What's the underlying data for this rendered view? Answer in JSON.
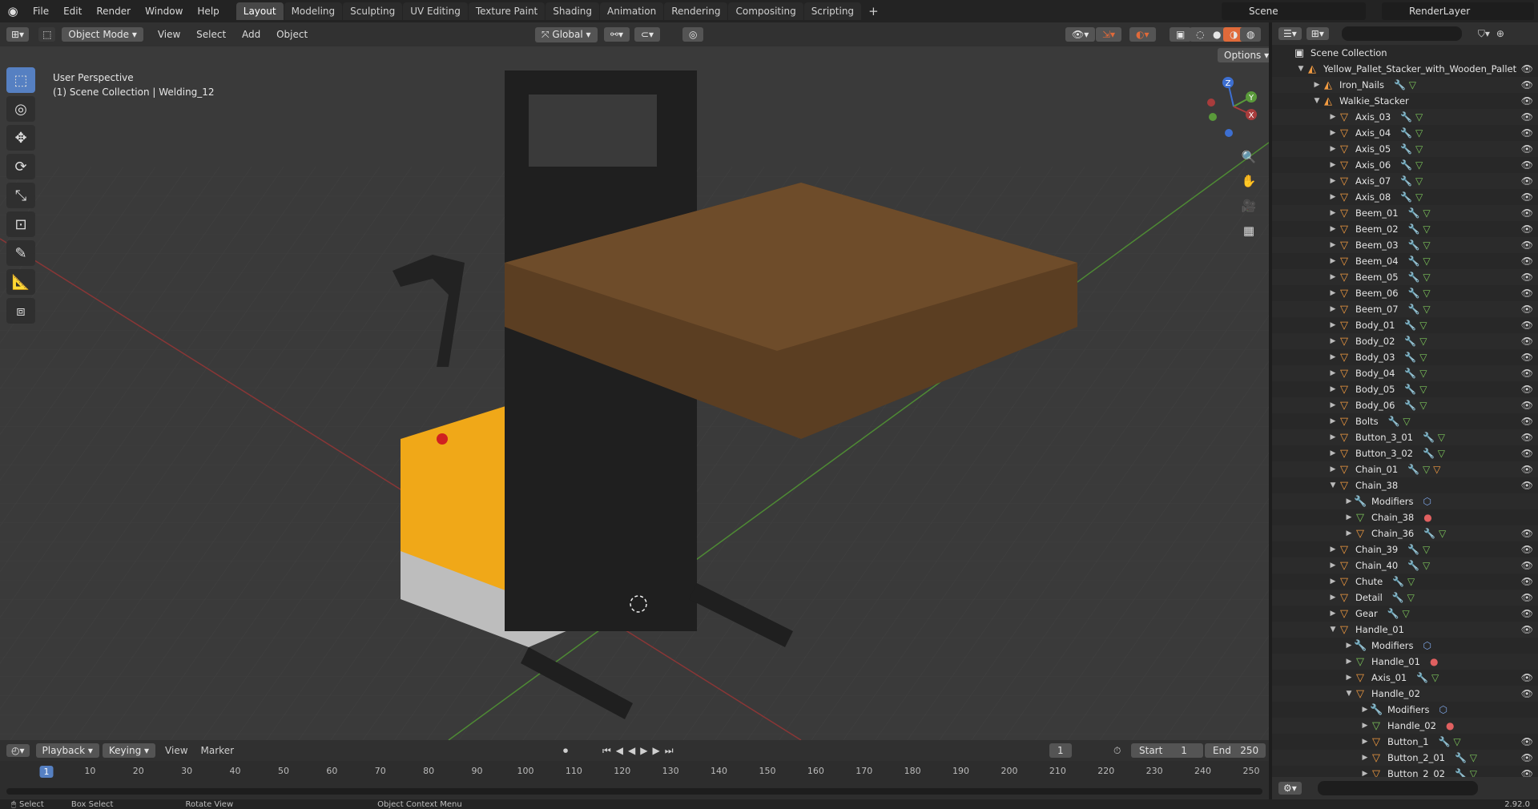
{
  "topbar": {
    "menus": [
      "File",
      "Edit",
      "Render",
      "Window",
      "Help"
    ],
    "workspaces": [
      "Layout",
      "Modeling",
      "Sculpting",
      "UV Editing",
      "Texture Paint",
      "Shading",
      "Animation",
      "Rendering",
      "Compositing",
      "Scripting"
    ],
    "active_workspace": "Layout",
    "add_tab": "+",
    "scene": "Scene",
    "render_layer": "RenderLayer"
  },
  "viewport": {
    "mode": "Object Mode",
    "menus": [
      "View",
      "Select",
      "Add",
      "Object"
    ],
    "transform_orientation": "Global",
    "options": "Options",
    "info_line1": "User Perspective",
    "info_line2": "(1) Scene Collection | Welding_12",
    "gizmo_axes": {
      "z": "Z",
      "y": "Y",
      "x": "X"
    },
    "colors": {
      "x_axis": "#a83c3c",
      "y_axis": "#5a9a3a",
      "z_axis": "#3d6fd1",
      "accent": "#5680c2",
      "yellow": "#f0a818"
    }
  },
  "outliner": {
    "root": "Scene Collection",
    "rows": [
      {
        "depth": 1,
        "label": "Yellow_Pallet_Stacker_with_Wooden_Pallet",
        "open": true,
        "icon": "armature",
        "extras": ""
      },
      {
        "depth": 2,
        "label": "Iron_Nails",
        "open": false,
        "icon": "armature",
        "extras": "mod-mesh"
      },
      {
        "depth": 2,
        "label": "Walkie_Stacker",
        "open": true,
        "icon": "armature",
        "extras": ""
      },
      {
        "depth": 3,
        "label": "Axis_03",
        "open": false,
        "icon": "mesh",
        "extras": "mod-mesh"
      },
      {
        "depth": 3,
        "label": "Axis_04",
        "open": false,
        "icon": "mesh",
        "extras": "mod-mesh"
      },
      {
        "depth": 3,
        "label": "Axis_05",
        "open": false,
        "icon": "mesh",
        "extras": "mod-mesh"
      },
      {
        "depth": 3,
        "label": "Axis_06",
        "open": false,
        "icon": "mesh",
        "extras": "mod-mesh"
      },
      {
        "depth": 3,
        "label": "Axis_07",
        "open": false,
        "icon": "mesh",
        "extras": "mod-mesh"
      },
      {
        "depth": 3,
        "label": "Axis_08",
        "open": false,
        "icon": "mesh",
        "extras": "mod-mesh"
      },
      {
        "depth": 3,
        "label": "Beem_01",
        "open": false,
        "icon": "mesh",
        "extras": "mod-mesh"
      },
      {
        "depth": 3,
        "label": "Beem_02",
        "open": false,
        "icon": "mesh",
        "extras": "mod-mesh"
      },
      {
        "depth": 3,
        "label": "Beem_03",
        "open": false,
        "icon": "mesh",
        "extras": "mod-mesh"
      },
      {
        "depth": 3,
        "label": "Beem_04",
        "open": false,
        "icon": "mesh",
        "extras": "mod-mesh"
      },
      {
        "depth": 3,
        "label": "Beem_05",
        "open": false,
        "icon": "mesh",
        "extras": "mod-mesh"
      },
      {
        "depth": 3,
        "label": "Beem_06",
        "open": false,
        "icon": "mesh",
        "extras": "mod-mesh"
      },
      {
        "depth": 3,
        "label": "Beem_07",
        "open": false,
        "icon": "mesh",
        "extras": "mod-mesh"
      },
      {
        "depth": 3,
        "label": "Body_01",
        "open": false,
        "icon": "mesh",
        "extras": "mod-mesh"
      },
      {
        "depth": 3,
        "label": "Body_02",
        "open": false,
        "icon": "mesh",
        "extras": "mod-mesh"
      },
      {
        "depth": 3,
        "label": "Body_03",
        "open": false,
        "icon": "mesh",
        "extras": "mod-mesh"
      },
      {
        "depth": 3,
        "label": "Body_04",
        "open": false,
        "icon": "mesh",
        "extras": "mod-mesh"
      },
      {
        "depth": 3,
        "label": "Body_05",
        "open": false,
        "icon": "mesh",
        "extras": "mod-mesh"
      },
      {
        "depth": 3,
        "label": "Body_06",
        "open": false,
        "icon": "mesh",
        "extras": "mod-mesh"
      },
      {
        "depth": 3,
        "label": "Bolts",
        "open": false,
        "icon": "mesh",
        "extras": "mod-mesh"
      },
      {
        "depth": 3,
        "label": "Button_3_01",
        "open": false,
        "icon": "mesh",
        "extras": "mod-mesh"
      },
      {
        "depth": 3,
        "label": "Button_3_02",
        "open": false,
        "icon": "mesh",
        "extras": "mod-mesh"
      },
      {
        "depth": 3,
        "label": "Chain_01",
        "open": false,
        "icon": "mesh",
        "extras": "mod-mesh-child"
      },
      {
        "depth": 3,
        "label": "Chain_38",
        "open": true,
        "icon": "mesh",
        "extras": ""
      },
      {
        "depth": 4,
        "label": "Modifiers",
        "open": false,
        "icon": "wrench",
        "extras": "modifier"
      },
      {
        "depth": 4,
        "label": "Chain_38",
        "open": false,
        "icon": "meshdata",
        "extras": "material"
      },
      {
        "depth": 4,
        "label": "Chain_36",
        "open": false,
        "icon": "mesh",
        "extras": "mod-mesh"
      },
      {
        "depth": 3,
        "label": "Chain_39",
        "open": false,
        "icon": "mesh",
        "extras": "mod-mesh"
      },
      {
        "depth": 3,
        "label": "Chain_40",
        "open": false,
        "icon": "mesh",
        "extras": "mod-mesh"
      },
      {
        "depth": 3,
        "label": "Chute",
        "open": false,
        "icon": "mesh",
        "extras": "mod-mesh"
      },
      {
        "depth": 3,
        "label": "Detail",
        "open": false,
        "icon": "mesh",
        "extras": "mod-mesh"
      },
      {
        "depth": 3,
        "label": "Gear",
        "open": false,
        "icon": "mesh",
        "extras": "mod-mesh"
      },
      {
        "depth": 3,
        "label": "Handle_01",
        "open": true,
        "icon": "mesh",
        "extras": ""
      },
      {
        "depth": 4,
        "label": "Modifiers",
        "open": false,
        "icon": "wrench",
        "extras": "modifier"
      },
      {
        "depth": 4,
        "label": "Handle_01",
        "open": false,
        "icon": "meshdata",
        "extras": "material"
      },
      {
        "depth": 4,
        "label": "Axis_01",
        "open": false,
        "icon": "mesh",
        "extras": "mod-mesh"
      },
      {
        "depth": 4,
        "label": "Handle_02",
        "open": true,
        "icon": "mesh",
        "extras": ""
      },
      {
        "depth": 5,
        "label": "Modifiers",
        "open": false,
        "icon": "wrench",
        "extras": "modifier"
      },
      {
        "depth": 5,
        "label": "Handle_02",
        "open": false,
        "icon": "meshdata",
        "extras": "material"
      },
      {
        "depth": 5,
        "label": "Button_1",
        "open": false,
        "icon": "mesh",
        "extras": "mod-mesh"
      },
      {
        "depth": 5,
        "label": "Button_2_01",
        "open": false,
        "icon": "mesh",
        "extras": "mod-mesh"
      },
      {
        "depth": 5,
        "label": "Button_2_02",
        "open": false,
        "icon": "mesh",
        "extras": "mod-mesh"
      }
    ]
  },
  "timeline": {
    "menus": [
      "Playback",
      "Keying",
      "View",
      "Marker"
    ],
    "current_frame": "1",
    "start_label": "Start",
    "start": "1",
    "end_label": "End",
    "end": "250",
    "ruler": [
      "1",
      "10",
      "20",
      "30",
      "40",
      "50",
      "60",
      "70",
      "80",
      "90",
      "100",
      "110",
      "120",
      "130",
      "140",
      "150",
      "160",
      "170",
      "180",
      "190",
      "200",
      "210",
      "220",
      "230",
      "240",
      "250"
    ]
  },
  "statusbar": {
    "items": [
      "Select",
      "Box Select",
      "Rotate View",
      "Object Context Menu"
    ],
    "version": "2.92.0"
  }
}
